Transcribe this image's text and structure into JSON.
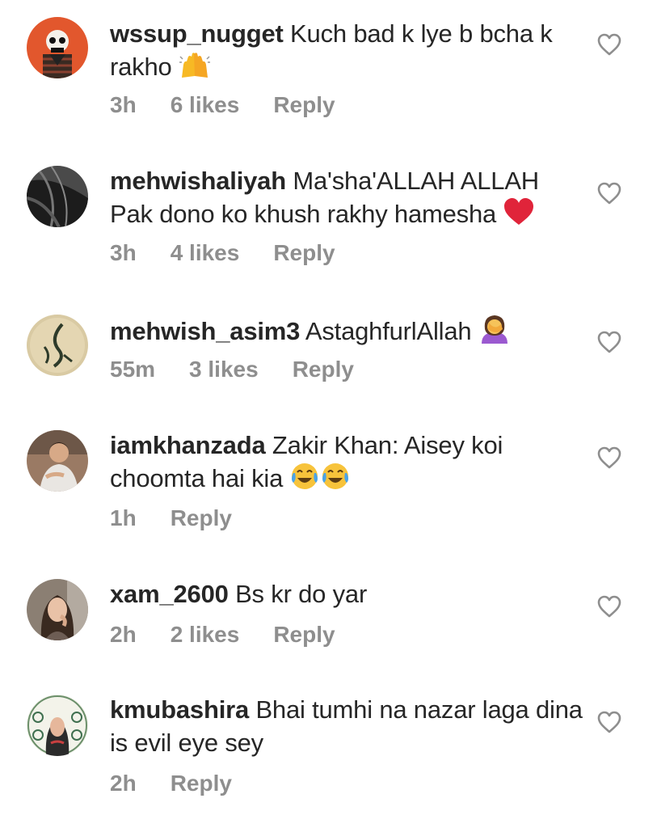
{
  "comments": [
    {
      "username": "wssup_nugget",
      "text": "Kuch bad k lye b bcha k rakho",
      "emoji_after": "raising-hands-emoji",
      "time": "3h",
      "likes": "6 likes",
      "reply_label": "Reply"
    },
    {
      "username": "mehwishaliyah",
      "text": "Ma'sha'ALLAH ALLAH Pak dono ko khush rakhy hamesha",
      "emoji_after": "red-heart-emoji",
      "time": "3h",
      "likes": "4 likes",
      "reply_label": "Reply"
    },
    {
      "username": "mehwish_asim3",
      "text": "AstaghfurlAllah",
      "emoji_after": "woman-facepalming-emoji",
      "time": "55m",
      "likes": "3 likes",
      "reply_label": "Reply"
    },
    {
      "username": "iamkhanzada",
      "text": "Zakir Khan: Aisey koi choomta hai kia",
      "emoji_after": "tears-of-joy-emoji",
      "time": "1h",
      "likes": "",
      "reply_label": "Reply"
    },
    {
      "username": "xam_2600",
      "text": "Bs kr do yar",
      "emoji_after": "",
      "time": "2h",
      "likes": "2 likes",
      "reply_label": "Reply"
    },
    {
      "username": "kmubashira",
      "text": "Bhai tumhi na nazar laga dina is evil eye sey",
      "emoji_after": "",
      "time": "2h",
      "likes": "",
      "reply_label": "Reply"
    }
  ],
  "colors": {
    "text": "#262626",
    "meta": "#8e8e8e",
    "heart_outline": "#8e8e8e",
    "heart_emoji": "#e0243a"
  },
  "icons": {
    "like": "heart-outline-icon"
  }
}
